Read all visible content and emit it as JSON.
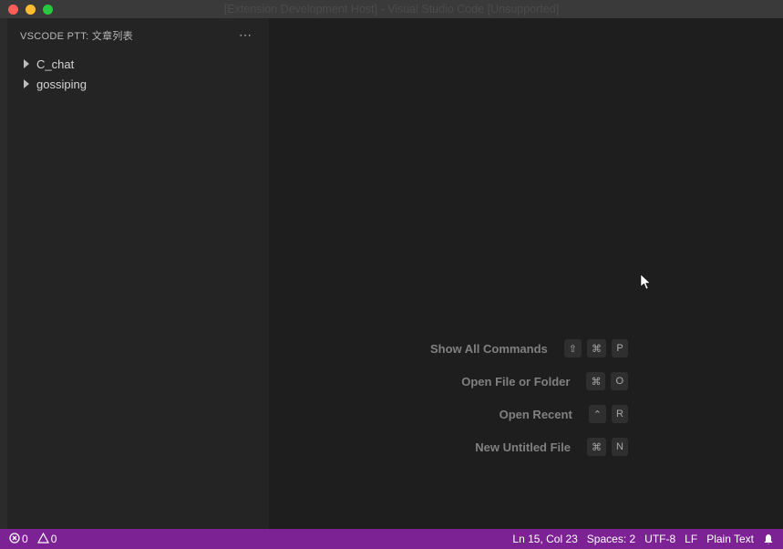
{
  "titlebar": {
    "title": "[Extension Development Host] - Visual Studio Code [Unsupported]"
  },
  "sidebar": {
    "title": "VSCODE PTT: 文章列表",
    "more": "⋯",
    "items": [
      {
        "label": "C_chat"
      },
      {
        "label": "gossiping"
      }
    ]
  },
  "welcome": {
    "commands": [
      {
        "label": "Show All Commands",
        "keys": [
          "⇧",
          "⌘",
          "P"
        ]
      },
      {
        "label": "Open File or Folder",
        "keys": [
          "⌘",
          "O"
        ]
      },
      {
        "label": "Open Recent",
        "keys": [
          "⌃",
          "R"
        ]
      },
      {
        "label": "New Untitled File",
        "keys": [
          "⌘",
          "N"
        ]
      }
    ]
  },
  "statusbar": {
    "errors": "0",
    "warnings": "0",
    "cursor": "Ln 15, Col 23",
    "spaces": "Spaces: 2",
    "encoding": "UTF-8",
    "eol": "LF",
    "language": "Plain Text"
  }
}
